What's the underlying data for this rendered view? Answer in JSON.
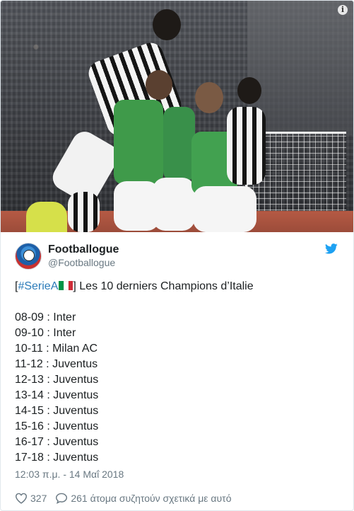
{
  "media": {
    "info_icon": "info-icon"
  },
  "author": {
    "display_name": "Footballogue",
    "handle": "@Footballogue"
  },
  "tweet": {
    "open_bracket": "[",
    "hashtag": "#SerieA",
    "title_rest": "] Les 10 derniers Champions d’Italie",
    "flag_colors": [
      "#009246",
      "#ffffff",
      "#ce2b37"
    ],
    "champions": [
      {
        "season": "08-09",
        "team": "Inter"
      },
      {
        "season": "09-10",
        "team": "Inter"
      },
      {
        "season": "10-11",
        "team": "Milan AC"
      },
      {
        "season": "11-12",
        "team": "Juventus"
      },
      {
        "season": "12-13",
        "team": "Juventus"
      },
      {
        "season": "13-14",
        "team": "Juventus"
      },
      {
        "season": "14-15",
        "team": "Juventus"
      },
      {
        "season": "15-16",
        "team": "Juventus"
      },
      {
        "season": "16-17",
        "team": "Juventus"
      },
      {
        "season": "17-18",
        "team": "Juventus"
      }
    ],
    "separator": " : ",
    "timestamp": "12:03 π.μ. - 14 Μαΐ 2018"
  },
  "actions": {
    "likes": "327",
    "replies_label": "261 άτομα συζητούν σχετικά με αυτό"
  },
  "colors": {
    "link": "#2b7bb9",
    "twitter_blue": "#1da1f2",
    "meta": "#697882"
  }
}
